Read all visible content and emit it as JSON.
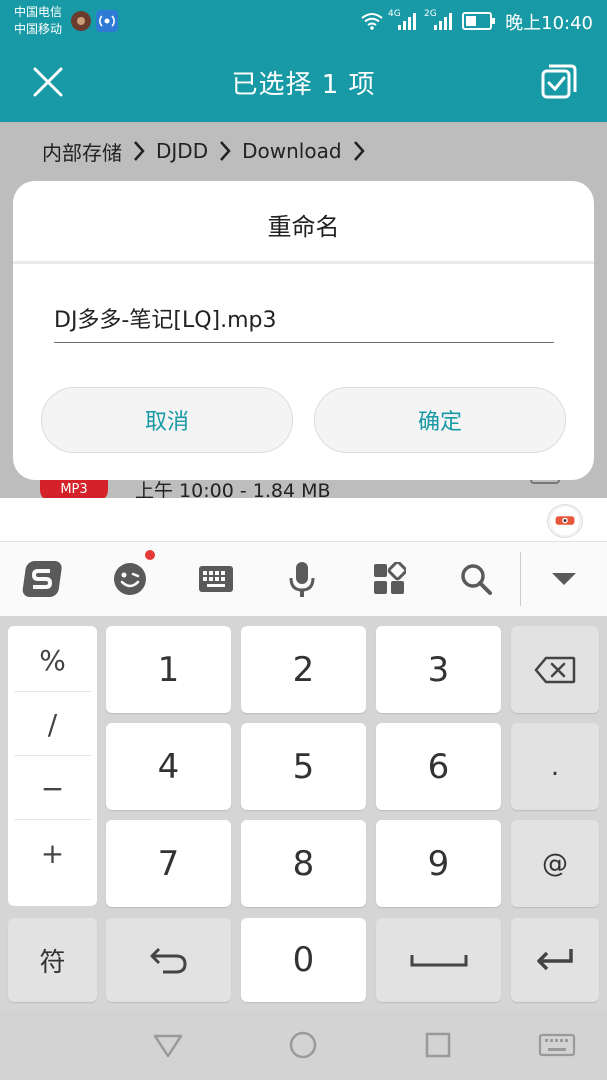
{
  "status_bar": {
    "carrier1": "中国电信",
    "carrier2": "中国移动",
    "net_label_1": "4G",
    "net_label_2": "2G",
    "time": "晚上10:40"
  },
  "title_bar": {
    "title": "已选择 1 项"
  },
  "breadcrumb": [
    "内部存储",
    "DJDD",
    "Download"
  ],
  "file_row": {
    "badge": "MP3",
    "meta": "上午 10:00 - 1.84 MB"
  },
  "dialog": {
    "title": "重命名",
    "filename": "DJ多多-笔记[LQ].mp3",
    "cancel_label": "取消",
    "ok_label": "确定"
  },
  "keyboard": {
    "symbols": [
      "%",
      "/",
      "−",
      "+"
    ],
    "keys": [
      "1",
      "2",
      "3",
      "4",
      "5",
      "6",
      "7",
      "8",
      "9",
      "0"
    ],
    "dot": ".",
    "at": "@",
    "fu": "符"
  },
  "colors": {
    "accent": "#179aa6",
    "badge_red": "#d4212a"
  }
}
